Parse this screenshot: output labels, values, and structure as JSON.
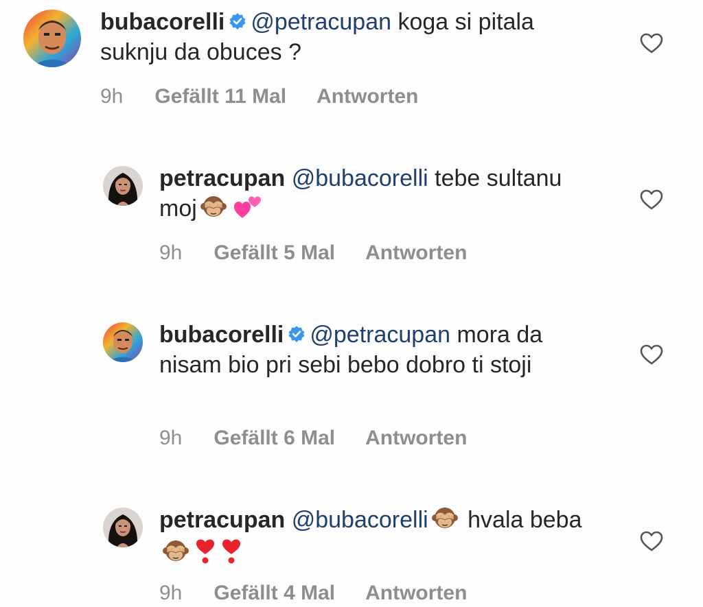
{
  "comments": [
    {
      "username": "bubacorelli",
      "mention": "@petracupan",
      "text": "koga si pitala suknju da obuces ?",
      "time": "9h",
      "likes": "Gefällt 11 Mal",
      "reply": "Antworten",
      "verified": true
    },
    {
      "username": "petracupan",
      "mention": "@bubacorelli",
      "text": "tebe sultanu moj",
      "time": "9h",
      "likes": "Gefällt 5 Mal",
      "reply": "Antworten",
      "verified": false
    },
    {
      "username": "bubacorelli",
      "mention": "@petracupan",
      "text": "mora da nisam bio pri sebi bebo dobro ti stoji",
      "time": "9h",
      "likes": "Gefällt 6 Mal",
      "reply": "Antworten",
      "verified": true
    },
    {
      "username": "petracupan",
      "mention": "@bubacorelli",
      "text_a": "hvala",
      "text_b": "beba",
      "time": "9h",
      "likes": "Gefällt 4 Mal",
      "reply": "Antworten",
      "verified": false
    }
  ],
  "colors": {
    "text": "#262626",
    "mention": "#1f3f6e",
    "meta": "#8e8e8e",
    "verified": "#3897f0"
  }
}
